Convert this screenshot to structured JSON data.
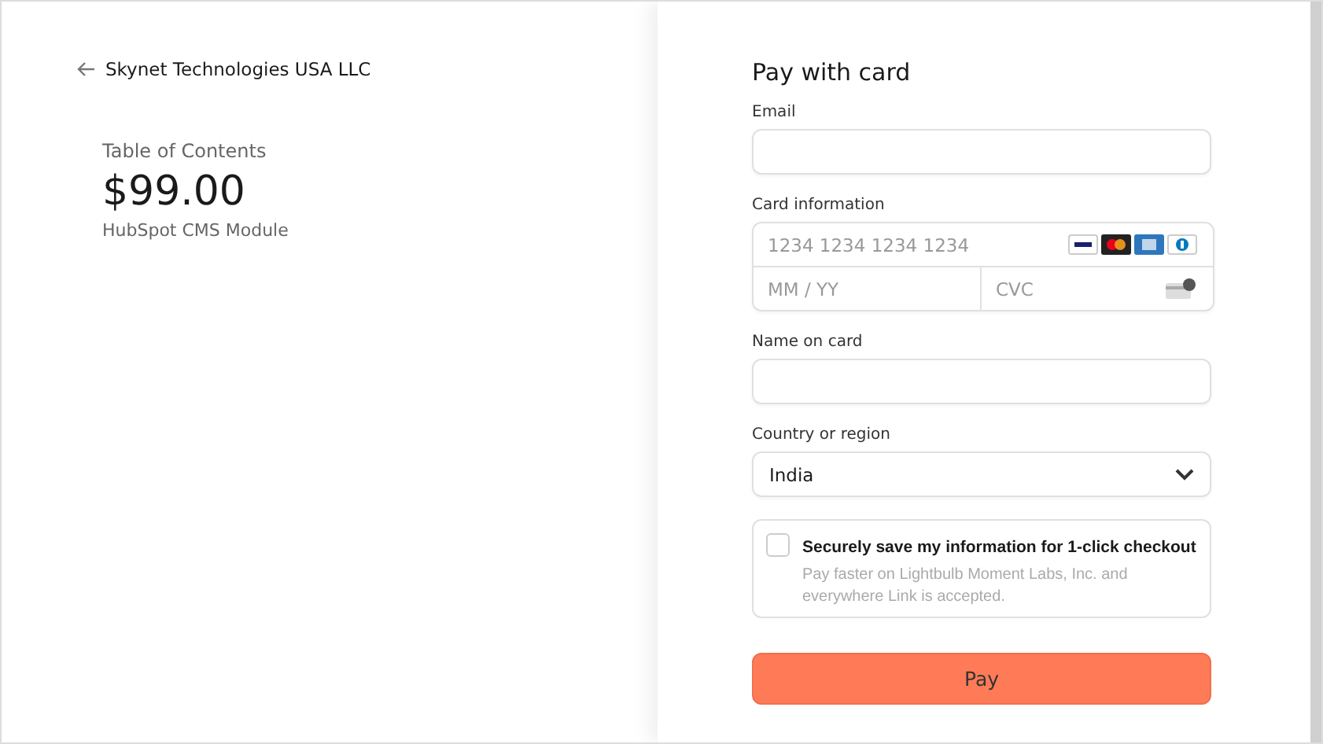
{
  "merchant": {
    "name": "Skynet Technologies USA LLC"
  },
  "product": {
    "name": "Table of Contents",
    "price": "$99.00",
    "description": "HubSpot CMS Module"
  },
  "form": {
    "title": "Pay with card",
    "email": {
      "label": "Email"
    },
    "card": {
      "label": "Card information",
      "number_placeholder": "1234 1234 1234 1234",
      "expiry_placeholder": "MM / YY",
      "cvc_placeholder": "CVC"
    },
    "name": {
      "label": "Name on card"
    },
    "country": {
      "label": "Country or region",
      "value": "India"
    },
    "save": {
      "checked": false,
      "label": "Securely save my information for 1-click checkout",
      "note": "Pay faster on Lightbulb Moment Labs, Inc. and everywhere Link is accepted."
    },
    "pay_button": "Pay"
  }
}
